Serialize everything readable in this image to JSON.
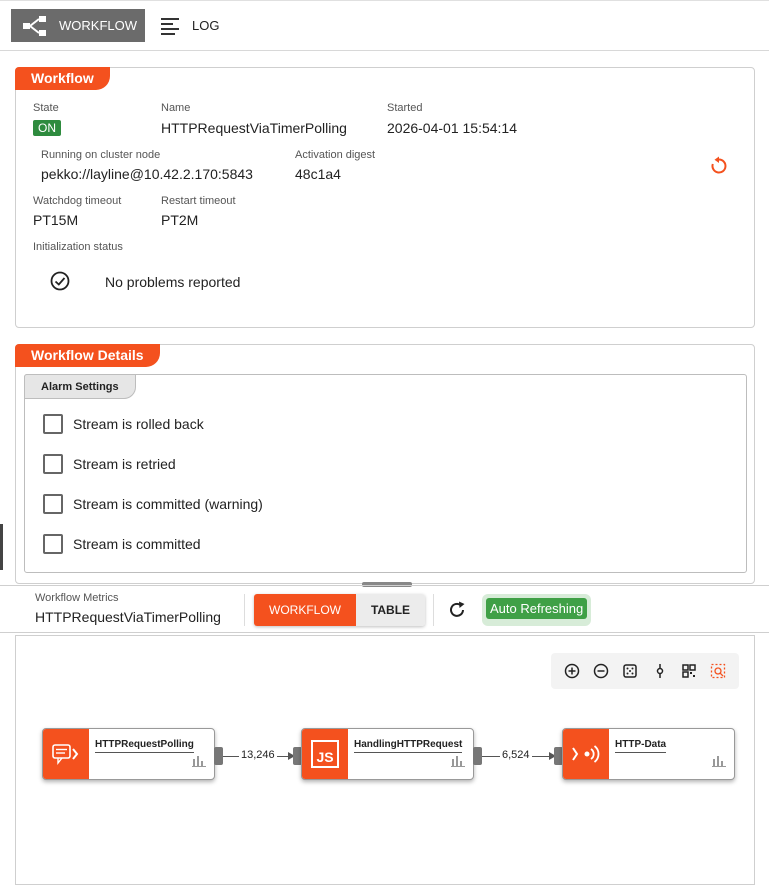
{
  "tabs": {
    "workflow": "WORKFLOW",
    "log": "LOG"
  },
  "workflow_card": {
    "title": "Workflow",
    "state_label": "State",
    "state_value": "ON",
    "name_label": "Name",
    "name_value": "HTTPRequestViaTimerPolling",
    "started_label": "Started",
    "started_value": "2026-04-01 15:54:14",
    "node_label": "Running on cluster node",
    "node_value": "pekko://layline@10.42.2.170:5843",
    "digest_label": "Activation digest",
    "digest_value": "48c1a4",
    "watchdog_label": "Watchdog timeout",
    "watchdog_value": "PT15M",
    "restart_label": "Restart timeout",
    "restart_value": "PT2M",
    "init_label": "Initialization status",
    "init_value": "No problems reported"
  },
  "details_card": {
    "title": "Workflow Details",
    "tab": "Alarm Settings",
    "checkboxes": [
      "Stream is rolled back",
      "Stream is retried",
      "Stream is committed (warning)",
      "Stream is committed"
    ]
  },
  "metrics": {
    "label": "Workflow Metrics",
    "name": "HTTPRequestViaTimerPolling",
    "toggle_workflow": "WORKFLOW",
    "toggle_table": "TABLE",
    "auto_refresh": "Auto Refreshing"
  },
  "graph": {
    "nodes": [
      {
        "name": "HTTPRequestPolling",
        "icon": "message-icon"
      },
      {
        "name": "HandlingHTTPRequest",
        "icon": "js-icon"
      },
      {
        "name": "HTTP-Data",
        "icon": "broadcast-icon"
      }
    ],
    "edges": [
      "13,246",
      "6,524"
    ]
  },
  "colors": {
    "accent": "#f4511e",
    "on": "#2e8b3e",
    "auto": "#3fa046"
  }
}
